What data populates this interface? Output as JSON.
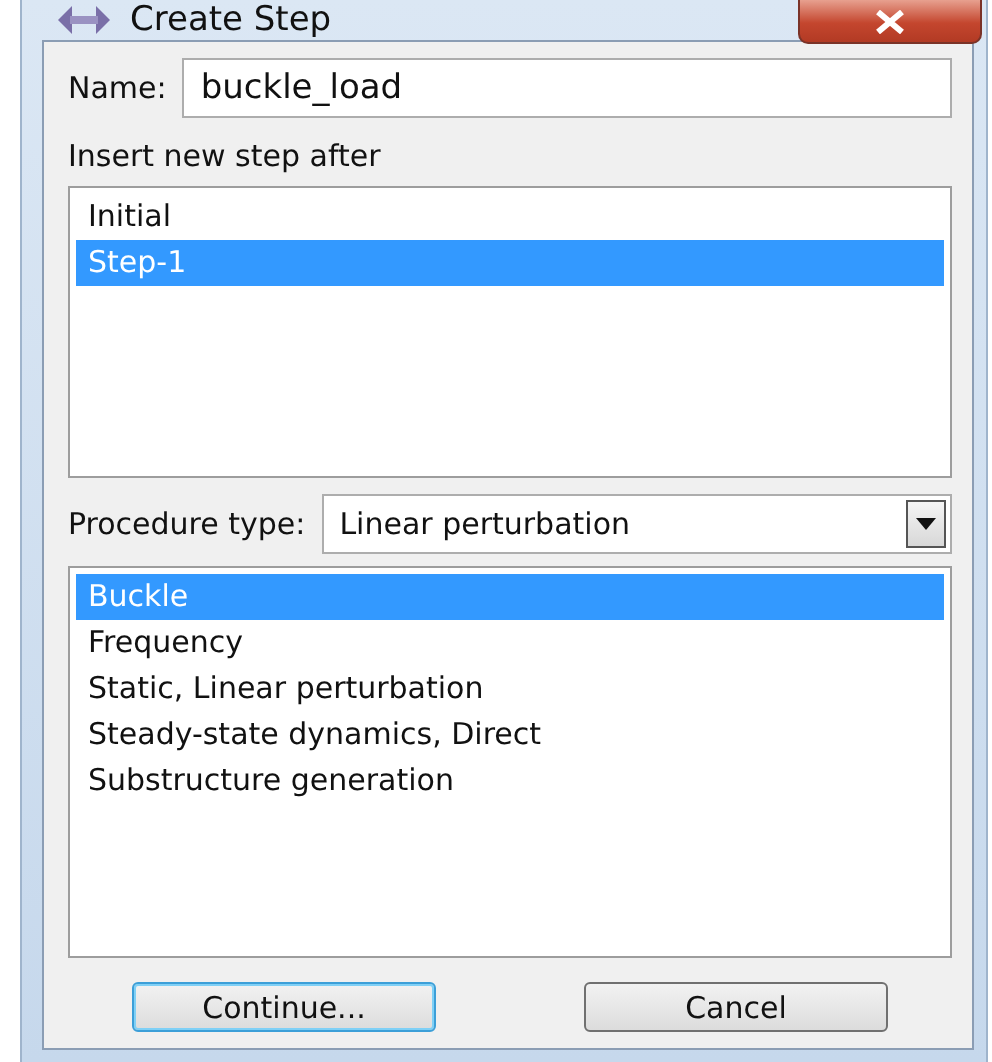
{
  "window": {
    "title": "Create Step"
  },
  "name_field": {
    "label": "Name:",
    "value": "buckle_load"
  },
  "insert_after": {
    "label": "Insert new step after",
    "items": [
      {
        "label": "Initial",
        "selected": false
      },
      {
        "label": "Step-1",
        "selected": true
      }
    ]
  },
  "procedure_type": {
    "label": "Procedure type:",
    "value": "Linear perturbation"
  },
  "procedures": [
    {
      "label": "Buckle",
      "selected": true
    },
    {
      "label": "Frequency",
      "selected": false
    },
    {
      "label": "Static, Linear perturbation",
      "selected": false
    },
    {
      "label": "Steady-state dynamics, Direct",
      "selected": false
    },
    {
      "label": "Substructure generation",
      "selected": false
    }
  ],
  "buttons": [
    {
      "label": "Continue...",
      "default": true
    },
    {
      "label": "Cancel",
      "default": false
    }
  ]
}
